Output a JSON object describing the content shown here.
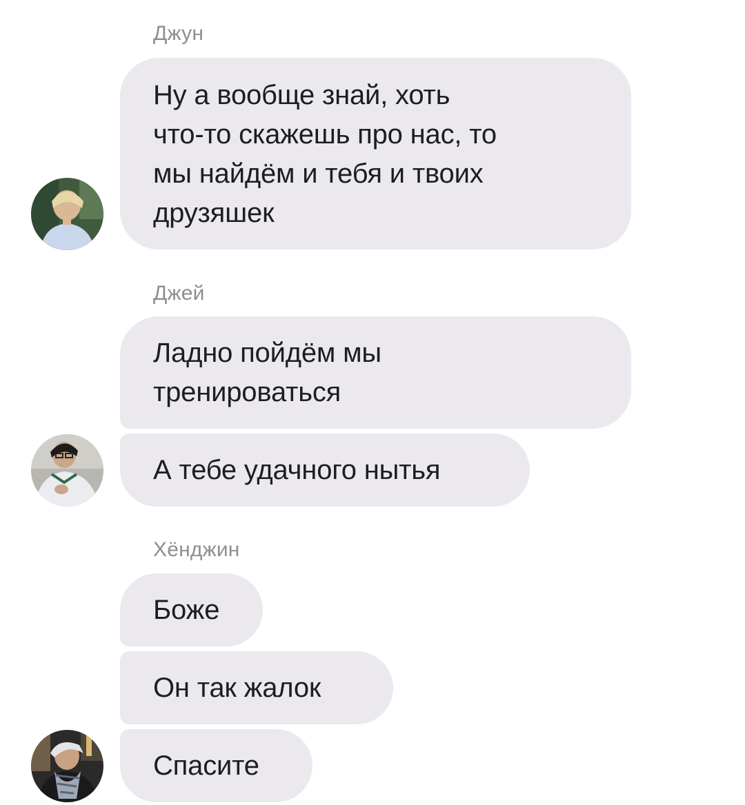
{
  "chat": {
    "groups": [
      {
        "sender": "Джун",
        "messages": [
          "Ну а вообще знай, хоть\nчто-то скажешь про нас, то\nмы найдём и тебя и твоих\nдрузяшек"
        ],
        "avatar_icon": "user-avatar-photo"
      },
      {
        "sender": "Джей",
        "messages": [
          "Ладно пойдём мы\nтренироваться",
          "А тебе удачного нытья"
        ],
        "avatar_icon": "user-avatar-photo"
      },
      {
        "sender": "Хёнджин",
        "messages": [
          "Боже",
          "Он так жалок",
          "Спасите"
        ],
        "avatar_icon": "user-avatar-photo"
      }
    ]
  },
  "colors": {
    "bubble": "#ebe9ee",
    "sender_name": "#8e8e92",
    "text": "#1e1e1e"
  }
}
